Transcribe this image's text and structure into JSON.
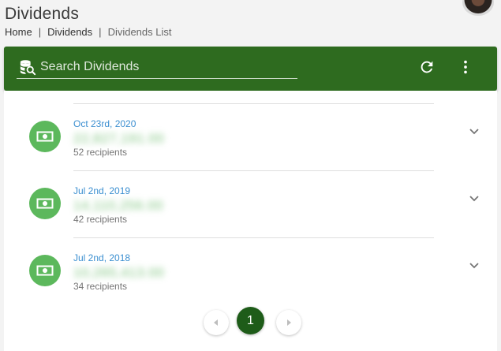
{
  "header": {
    "title": "Dividends",
    "breadcrumb": [
      "Home",
      "Dividends",
      "Dividends List"
    ]
  },
  "toolbar": {
    "search_placeholder": "Search Dividends",
    "accent_color": "#2e6b1f"
  },
  "dividends": [
    {
      "date": "Oct 23rd, 2020",
      "amount": "22,827,191.00",
      "recipients": "52 recipients"
    },
    {
      "date": "Jul 2nd, 2019",
      "amount": "14,110,256.00",
      "recipients": "42 recipients"
    },
    {
      "date": "Jul 2nd, 2018",
      "amount": "10,265,413.00",
      "recipients": "34 recipients"
    }
  ],
  "pagination": {
    "current_page": "1"
  },
  "icons": {
    "search": "database-search-icon",
    "refresh": "refresh-icon",
    "more": "more-vert-icon",
    "dividend": "cash-icon",
    "expand": "chevron-down-icon"
  }
}
